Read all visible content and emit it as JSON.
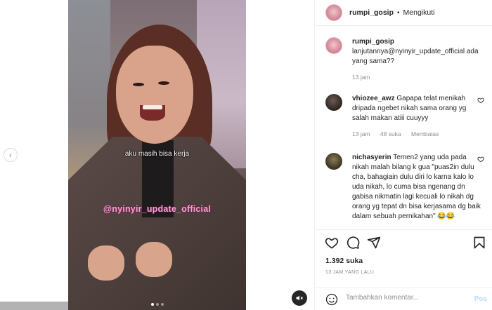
{
  "post": {
    "username": "rumpi_gosip",
    "follow_status": "Mengikuti",
    "separator": "•",
    "video_caption": "aku masih bisa kerja",
    "video_watermark": "@nyinyir_update_official",
    "likes": "1.392 suka",
    "timestamp": "13 JAM YANG LALU"
  },
  "comments": [
    {
      "username": "rumpi_gosip",
      "text": "lanjutannya@nyinyir_update_official ada yang sama??",
      "time": "13 jam"
    },
    {
      "username": "vhiozee_awz",
      "text": "Gapapa telat menikah dripada ngebet nikah sama orang yg salah makan atiii cuuyyy",
      "time": "13 jam",
      "likes": "48 suka",
      "reply": "Membalas"
    },
    {
      "username": "nichasyerin",
      "text": "Temen2 yang uda pada nikah malah bilang k gua \"puas2in dulu cha, bahagiain dulu diri lo karna kalo lo uda nikah, lo cuma bisa ngenang dn gabisa nikmatin lagi kecuali lo nikah dg orang yg tepat dn bisa kerjasama dg baik dalam sebuah pernikahan\" 😂😂"
    }
  ],
  "add_comment": {
    "placeholder": "Tambahkan komentar...",
    "post_label": "Pos"
  },
  "icons": {
    "heart": "heart-icon",
    "comment": "comment-icon",
    "share": "share-icon",
    "save": "bookmark-icon",
    "mute": "speaker-muted-icon",
    "prev": "chevron-left-icon",
    "emoji": "emoji-icon"
  },
  "colors": {
    "watermark": "#ff9ad6",
    "muted_text": "#8e8e8e",
    "post_button": "#b2dffc"
  }
}
